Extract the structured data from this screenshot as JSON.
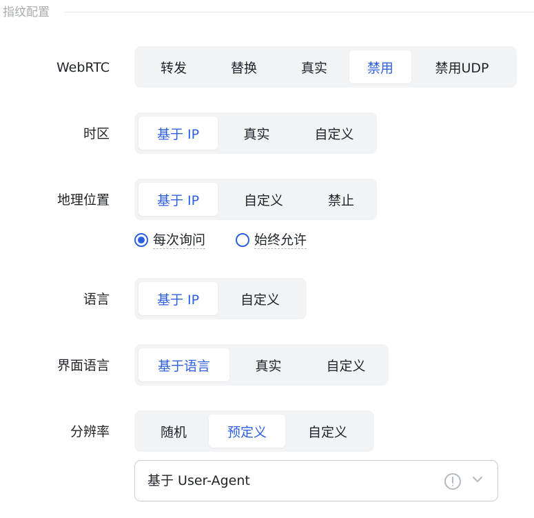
{
  "section": {
    "title": "指纹配置"
  },
  "webrtc": {
    "label": "WebRTC",
    "options": [
      "转发",
      "替换",
      "真实",
      "禁用",
      "禁用UDP"
    ],
    "selected": "禁用"
  },
  "timezone": {
    "label": "时区",
    "options": [
      "基于 IP",
      "真实",
      "自定义"
    ],
    "selected": "基于 IP"
  },
  "geolocation": {
    "label": "地理位置",
    "options": [
      "基于 IP",
      "自定义",
      "禁止"
    ],
    "selected": "基于 IP",
    "permission": {
      "options": [
        "每次询问",
        "始终允许"
      ],
      "selected": "每次询问"
    }
  },
  "language": {
    "label": "语言",
    "options": [
      "基于 IP",
      "自定义"
    ],
    "selected": "基于 IP"
  },
  "ui_language": {
    "label": "界面语言",
    "options": [
      "基于语言",
      "真实",
      "自定义"
    ],
    "selected": "基于语言"
  },
  "resolution": {
    "label": "分辨率",
    "options": [
      "随机",
      "预定义",
      "自定义"
    ],
    "selected": "预定义",
    "select_value": "基于 User-Agent"
  },
  "colors": {
    "accent": "#2c5fe0",
    "segment_bg": "#f2f3f5",
    "muted": "#a8abb2"
  },
  "icons": {
    "info": "info-icon",
    "dropdown": "chevron-down-icon"
  }
}
